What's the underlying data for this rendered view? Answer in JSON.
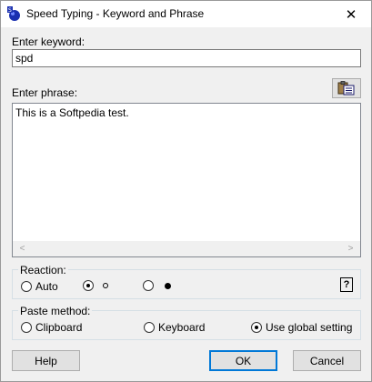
{
  "window": {
    "title": "Speed Typing - Keyword and Phrase",
    "close_symbol": "✕",
    "app_icon": "speed-typing-app-icon"
  },
  "keyword": {
    "label": "Enter keyword:",
    "value": "spd"
  },
  "phrase": {
    "label": "Enter phrase:",
    "value": "This is a Softpedia test.",
    "paste_icon": "clipboard-paste-icon",
    "scroll_left": "<",
    "scroll_right": ">"
  },
  "reaction": {
    "label": "Reaction:",
    "options": [
      {
        "label": "Auto",
        "checked": false
      },
      {
        "label": "",
        "checked": true,
        "glyph": "small-circle"
      },
      {
        "label": "",
        "checked": false,
        "glyph": "small-dot"
      }
    ],
    "help_label": "?"
  },
  "paste_method": {
    "label": "Paste method:",
    "options": [
      {
        "label": "Clipboard",
        "checked": false
      },
      {
        "label": "Keyboard",
        "checked": false
      },
      {
        "label": "Use global setting",
        "checked": true
      }
    ]
  },
  "buttons": {
    "help": "Help",
    "ok": "OK",
    "cancel": "Cancel"
  }
}
